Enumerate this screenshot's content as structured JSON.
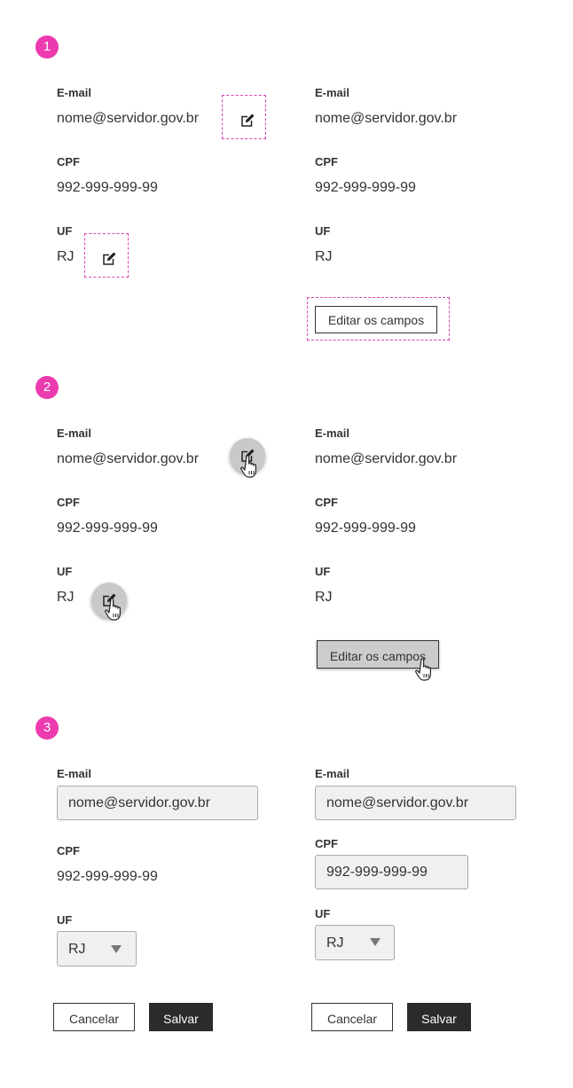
{
  "steps": [
    {
      "number": "1"
    },
    {
      "number": "2"
    },
    {
      "number": "3"
    }
  ],
  "fields": {
    "email_label": "E-mail",
    "email_value": "nome@servidor.gov.br",
    "cpf_label": "CPF",
    "cpf_value": "992-999-999-99",
    "uf_label": "UF",
    "uf_value": "RJ"
  },
  "buttons": {
    "edit_fields": "Editar os campos",
    "cancel": "Cancelar",
    "save": "Salvar"
  },
  "icons": {
    "edit": "edit-icon",
    "hand_cursor": "hand-pointer-icon",
    "dropdown": "caret-down-icon"
  },
  "colors": {
    "badge": "#ec3aaf",
    "dashed_outline": "#e040b0",
    "hover": "#c9c9c9",
    "input_bg": "#f1f0f0",
    "dark_button": "#2b2b2b"
  }
}
